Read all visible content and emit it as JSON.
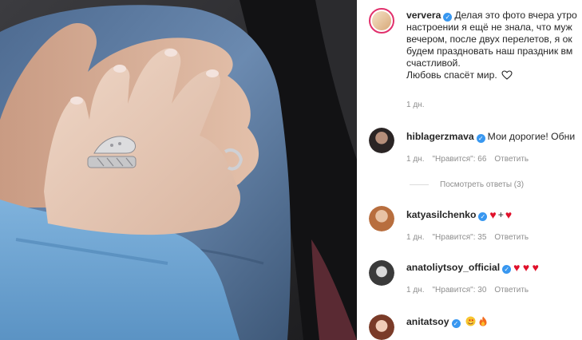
{
  "post": {
    "author": "ververa",
    "caption_lines": [
      "Делая это фото вчера утро",
      "настроении я ещё не знала, что муж",
      "вечером, после двух перелетов, я ок",
      "будем праздновать наш праздник вм",
      "счастливой.",
      "Любовь спасёт мир."
    ],
    "time": "1 дн."
  },
  "comments": [
    {
      "user": "hiblagerzmava",
      "text": "Мои дорогие! Обни",
      "time": "1 дн.",
      "likes": "\"Нравится\": 66",
      "reply": "Ответить",
      "view_replies": "Посмотреть ответы (3)"
    },
    {
      "user": "katyasilchenko",
      "plus": "+",
      "time": "1 дн.",
      "likes": "\"Нравится\": 35",
      "reply": "Ответить"
    },
    {
      "user": "anatoliytsoy_official",
      "time": "1 дн.",
      "likes": "\"Нравится\": 30",
      "reply": "Ответить"
    },
    {
      "user": "anitatsoy"
    }
  ],
  "icons": {
    "verified": "verified-badge-icon",
    "heart_outline": "heart-outline-icon",
    "red_heart": "red-heart-emoji",
    "star_struck": "star-struck-emoji",
    "fire": "fire-emoji"
  },
  "colors": {
    "verified": "#3897f0",
    "meta_text": "#8e8e8e",
    "heart": "#e0102a"
  }
}
